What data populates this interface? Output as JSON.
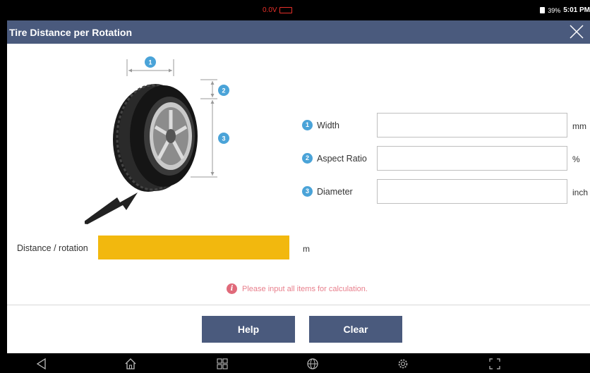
{
  "status": {
    "voltage": "0.0V",
    "battery_pct": "39%",
    "time": "5:01 PM"
  },
  "header": {
    "title": "Tire Distance per Rotation"
  },
  "diagram": {
    "markers": [
      "1",
      "2",
      "3"
    ]
  },
  "fields": [
    {
      "num": "1",
      "label": "Width",
      "value": "",
      "unit": "mm"
    },
    {
      "num": "2",
      "label": "Aspect Ratio",
      "value": "",
      "unit": "%"
    },
    {
      "num": "3",
      "label": "Diameter",
      "value": "",
      "unit": "inch"
    }
  ],
  "result": {
    "label": "Distance / rotation",
    "value": "",
    "unit": "m"
  },
  "message": "Please input all items for calculation.",
  "buttons": {
    "help": "Help",
    "clear": "Clear"
  },
  "colors": {
    "header": "#4a5a7d",
    "accent_blue": "#4aa3d8",
    "result_fill": "#f2b80e",
    "message": "#e87f8c",
    "voltage": "#e8302a"
  },
  "nav_icons": [
    "back-icon",
    "home-icon",
    "apps-icon",
    "globe-icon",
    "settings-icon",
    "screenshot-icon"
  ]
}
